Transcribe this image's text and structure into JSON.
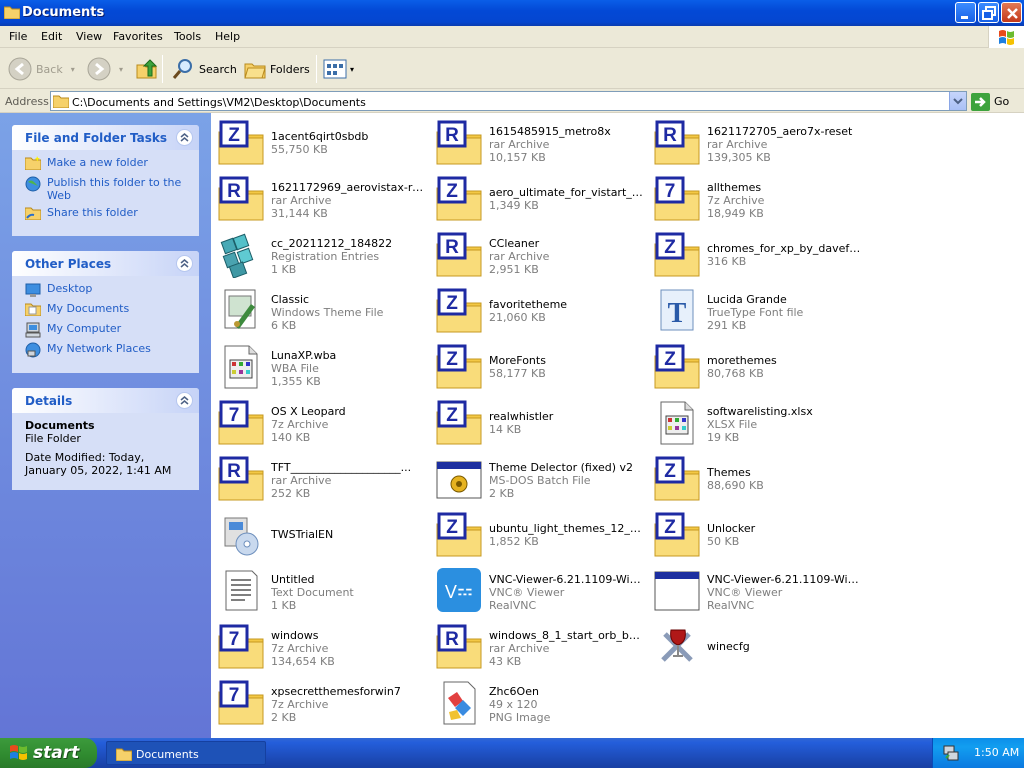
{
  "window": {
    "title": "Documents"
  },
  "menu": [
    "File",
    "Edit",
    "View",
    "Favorites",
    "Tools",
    "Help"
  ],
  "toolbar": {
    "back": "Back",
    "search": "Search",
    "folders": "Folders"
  },
  "address": {
    "label": "Address",
    "path": "C:\\Documents and Settings\\VM2\\Desktop\\Documents",
    "go": "Go"
  },
  "sidebar": {
    "tasks": {
      "title": "File and Folder Tasks",
      "items": [
        "Make a new folder",
        "Publish this folder to the Web",
        "Share this folder"
      ]
    },
    "places": {
      "title": "Other Places",
      "items": [
        "Desktop",
        "My Documents",
        "My Computer",
        "My Network Places"
      ]
    },
    "details": {
      "title": "Details",
      "name": "Documents",
      "type": "File Folder",
      "modified": "Date Modified: Today, January 05, 2022, 1:41 AM"
    }
  },
  "files": [
    {
      "name": "1acent6qirt0sbdb",
      "type": "",
      "size": "55,750 KB",
      "icon": "zip-icon"
    },
    {
      "name": "1615485915_metro8x",
      "type": "rar Archive",
      "size": "10,157 KB",
      "icon": "rar-icon"
    },
    {
      "name": "1621172705_aero7x-reset",
      "type": "rar Archive",
      "size": "139,305 KB",
      "icon": "rar-icon"
    },
    {
      "name": "1621172969_aerovistax-reset",
      "type": "rar Archive",
      "size": "31,144 KB",
      "icon": "rar-icon"
    },
    {
      "name": "aero_ultimate_for_vistart_by...",
      "type": "",
      "size": "1,349 KB",
      "icon": "zip-icon"
    },
    {
      "name": "allthemes",
      "type": "7z Archive",
      "size": "18,949 KB",
      "icon": "7z-icon"
    },
    {
      "name": "cc_20211212_184822",
      "type": "Registration Entries",
      "size": "1 KB",
      "icon": "registry-icon"
    },
    {
      "name": "CCleaner",
      "type": "rar Archive",
      "size": "2,951 KB",
      "icon": "rar-icon"
    },
    {
      "name": "chromes_for_xp_by_davef30...",
      "type": "",
      "size": "316 KB",
      "icon": "zip-icon"
    },
    {
      "name": "Classic",
      "type": "Windows Theme File",
      "size": "6 KB",
      "icon": "theme-file-icon"
    },
    {
      "name": "favoritetheme",
      "type": "",
      "size": "21,060 KB",
      "icon": "zip-icon"
    },
    {
      "name": "Lucida Grande",
      "type": "TrueType Font file",
      "size": "291 KB",
      "icon": "font-icon"
    },
    {
      "name": "LunaXP.wba",
      "type": "WBA File",
      "size": "1,355 KB",
      "icon": "wba-file-icon"
    },
    {
      "name": "MoreFonts",
      "type": "",
      "size": "58,177 KB",
      "icon": "zip-icon"
    },
    {
      "name": "morethemes",
      "type": "",
      "size": "80,768 KB",
      "icon": "zip-icon"
    },
    {
      "name": "OS X Leopard",
      "type": "7z Archive",
      "size": "140 KB",
      "icon": "7z-icon"
    },
    {
      "name": "realwhistler",
      "type": "",
      "size": "14 KB",
      "icon": "zip-icon"
    },
    {
      "name": "softwarelisting.xlsx",
      "type": "XLSX File",
      "size": "19 KB",
      "icon": "xlsx-file-icon"
    },
    {
      "name": "TFT____________________...",
      "type": "rar Archive",
      "size": "252 KB",
      "icon": "rar-icon"
    },
    {
      "name": "Theme Delector (fixed) v2",
      "type": "MS-DOS Batch File",
      "size": "2 KB",
      "icon": "batch-file-icon"
    },
    {
      "name": "Themes",
      "type": "",
      "size": "88,690 KB",
      "icon": "zip-icon"
    },
    {
      "name": "TWSTrialEN",
      "type": "",
      "size": "",
      "icon": "installer-icon"
    },
    {
      "name": "ubuntu_light_themes_12_10_...",
      "type": "",
      "size": "1,852 KB",
      "icon": "zip-icon"
    },
    {
      "name": "Unlocker",
      "type": "",
      "size": "50 KB",
      "icon": "zip-icon"
    },
    {
      "name": "Untitled",
      "type": "Text Document",
      "size": "1 KB",
      "icon": "text-file-icon"
    },
    {
      "name": "VNC-Viewer-6.21.1109-Windo...",
      "type": "VNC® Viewer",
      "size": "RealVNC",
      "icon": "vnc-icon"
    },
    {
      "name": "VNC-Viewer-6.21.1109-Windo...",
      "type": "VNC® Viewer",
      "size": "RealVNC",
      "icon": "vnc-window-icon"
    },
    {
      "name": "windows",
      "type": "7z Archive",
      "size": "134,654 KB",
      "icon": "7z-icon"
    },
    {
      "name": "windows_8_1_start_orb_by_n...",
      "type": "rar Archive",
      "size": "43 KB",
      "icon": "rar-icon"
    },
    {
      "name": "winecfg",
      "type": "",
      "size": "",
      "icon": "wine-icon"
    },
    {
      "name": "xpsecretthemesforwin7",
      "type": "7z Archive",
      "size": "2 KB",
      "icon": "7z-icon"
    },
    {
      "name": "Zhc6Oen",
      "type": "49 x 120",
      "size": "PNG Image",
      "icon": "png-file-icon"
    }
  ],
  "taskbar": {
    "start": "start",
    "task": "Documents",
    "clock": "1:50 AM"
  },
  "colors": {
    "titlebar": "#0349d6",
    "sidebar": "#6d8ce0",
    "link": "#215dc6",
    "folder": "#f8d775"
  }
}
